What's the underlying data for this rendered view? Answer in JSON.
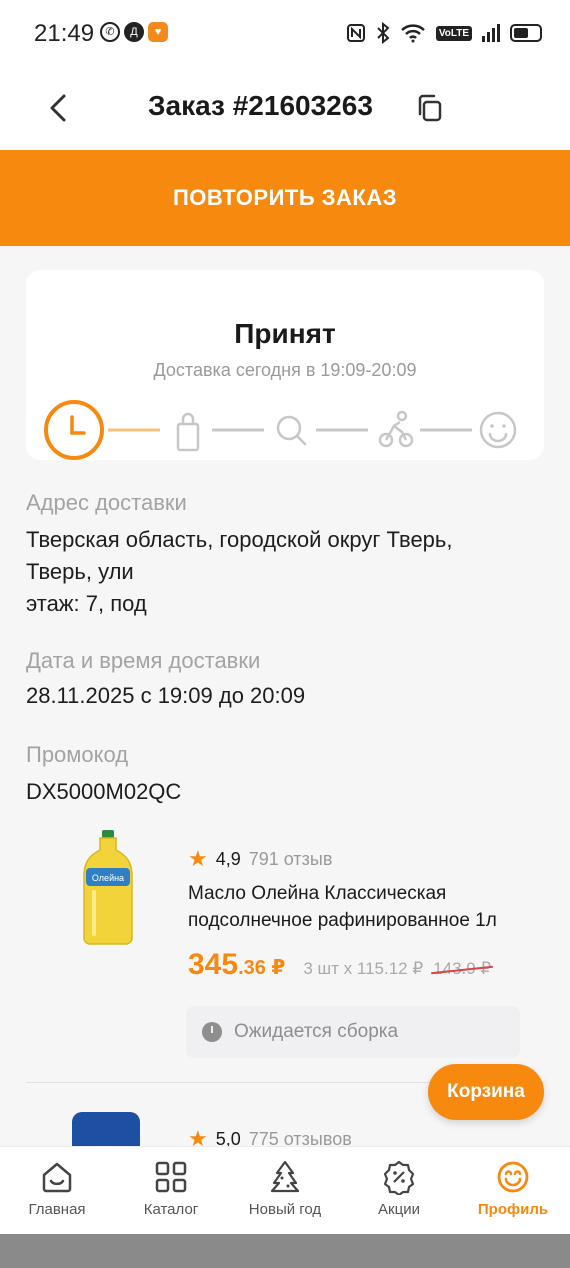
{
  "statusbar": {
    "time": "21:49",
    "volte": "VoLTE"
  },
  "header": {
    "title": "Заказ #21603263"
  },
  "repeat_button": "ПОВТОРИТЬ ЗАКАЗ",
  "status": {
    "title": "Принят",
    "subtitle": "Доставка сегодня в 19:09-20:09",
    "steps": [
      "clock-icon",
      "bag-icon",
      "search-icon",
      "courier-icon",
      "smile-icon"
    ],
    "active_step": 0
  },
  "delivery": {
    "address_label": "Адрес доставки",
    "address_line1": "Тверская область, городской округ Тверь,",
    "address_line2": "Тверь, ули",
    "address_line3": "этаж: 7, под",
    "datetime_label": "Дата и время доставки",
    "datetime_value": "28.11.2025 с 19:09 до 20:09",
    "promo_label": "Промокод",
    "promo_value": "DX5000M02QC"
  },
  "products": [
    {
      "rating": "4,9",
      "reviews": "791 отзыв",
      "name": "Масло Олейна Классическая подсолнечное рафинированное 1л",
      "price_main": "345",
      "price_frac": ".36 ₽",
      "qty": "3 шт х 115.12 ₽",
      "old_price": "143.9 ₽",
      "status": "Ожидается сборка",
      "bottle_label": "Олейна"
    },
    {
      "rating": "5,0",
      "reviews": "775 отзывов"
    }
  ],
  "cart_button": "Корзина",
  "tabbar": [
    {
      "label": "Главная",
      "icon": "home-icon",
      "active": false
    },
    {
      "label": "Каталог",
      "icon": "catalog-icon",
      "active": false
    },
    {
      "label": "Новый год",
      "icon": "tree-icon",
      "active": false
    },
    {
      "label": "Акции",
      "icon": "discount-icon",
      "active": false
    },
    {
      "label": "Профиль",
      "icon": "profile-icon",
      "active": true
    }
  ],
  "colors": {
    "accent": "#f7890f",
    "text": "#1f1f1f",
    "muted": "#a3a3a3"
  }
}
